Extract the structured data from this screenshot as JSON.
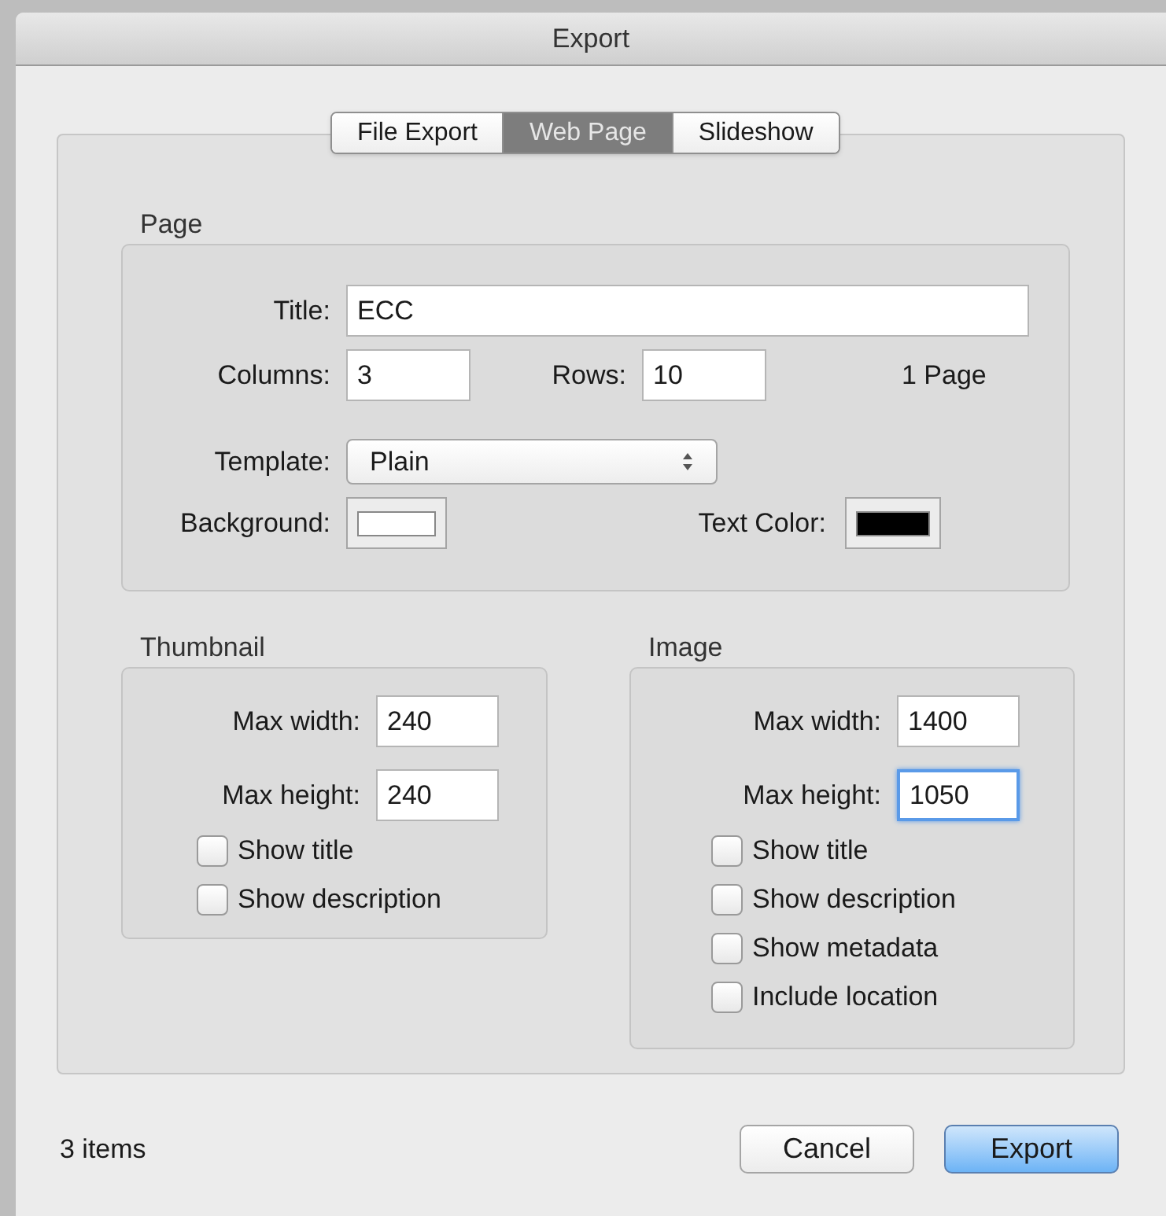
{
  "window": {
    "title": "Export"
  },
  "tabs": [
    {
      "label": "File Export",
      "selected": false
    },
    {
      "label": "Web Page",
      "selected": true
    },
    {
      "label": "Slideshow",
      "selected": false
    }
  ],
  "page": {
    "heading": "Page",
    "title": {
      "label": "Title:",
      "value": "ECC"
    },
    "columns": {
      "label": "Columns:",
      "value": "3"
    },
    "rows": {
      "label": "Rows:",
      "value": "10"
    },
    "page_count": "1 Page",
    "template": {
      "label": "Template:",
      "value": "Plain"
    },
    "background": {
      "label": "Background:",
      "color": "#ffffff"
    },
    "text_color": {
      "label": "Text Color:",
      "color": "#000000"
    }
  },
  "thumbnail": {
    "heading": "Thumbnail",
    "fields": [
      {
        "label": "Max width:",
        "value": "240",
        "focused": false
      },
      {
        "label": "Max height:",
        "value": "240",
        "focused": false
      }
    ],
    "checkboxes": [
      {
        "label": "Show title",
        "checked": false
      },
      {
        "label": "Show description",
        "checked": false
      }
    ]
  },
  "image": {
    "heading": "Image",
    "fields": [
      {
        "label": "Max width:",
        "value": "1400",
        "focused": false
      },
      {
        "label": "Max height:",
        "value": "1050",
        "focused": true
      }
    ],
    "checkboxes": [
      {
        "label": "Show title",
        "checked": false
      },
      {
        "label": "Show description",
        "checked": false
      },
      {
        "label": "Show metadata",
        "checked": false
      },
      {
        "label": "Include location",
        "checked": false
      }
    ]
  },
  "footer": {
    "status": "3 items",
    "buttons": [
      {
        "label": "Cancel",
        "default": false
      },
      {
        "label": "Export",
        "default": true
      }
    ]
  }
}
